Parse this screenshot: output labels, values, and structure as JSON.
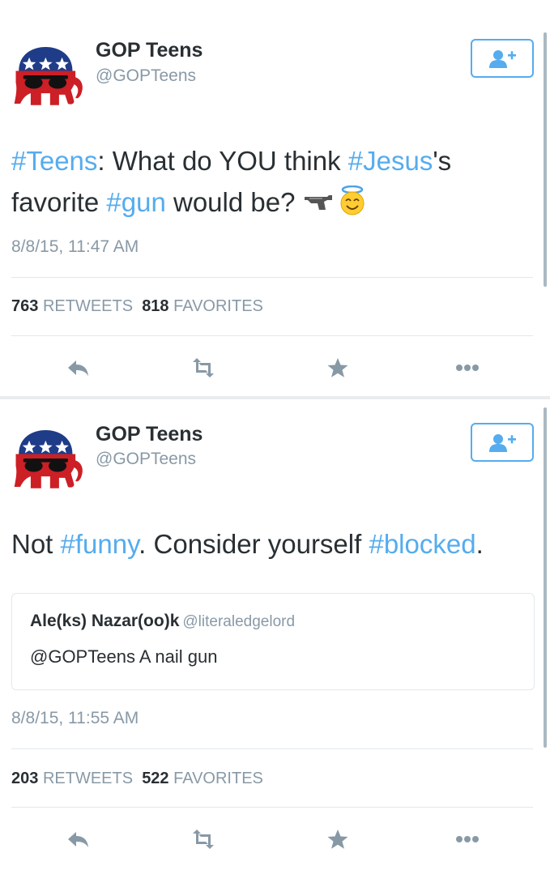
{
  "tweets": [
    {
      "name": "GOP Teens",
      "handle": "@GOPTeens",
      "text": [
        {
          "t": "#Teens",
          "hashtag": true
        },
        {
          "t": ": What do YOU think ",
          "hashtag": false
        },
        {
          "t": "#Jesus",
          "hashtag": true
        },
        {
          "t": "'s favorite ",
          "hashtag": false
        },
        {
          "t": "#gun",
          "hashtag": true
        },
        {
          "t": " would be? ",
          "hashtag": false
        }
      ],
      "emoji": [
        "gun-emoji",
        "angel-smile-emoji"
      ],
      "timestamp": "8/8/15, 11:47 AM",
      "retweets": "763",
      "retweets_label": "RETWEETS",
      "favorites": "818",
      "favorites_label": "FAVORITES"
    },
    {
      "name": "GOP Teens",
      "handle": "@GOPTeens",
      "text": [
        {
          "t": "Not ",
          "hashtag": false
        },
        {
          "t": "#funny",
          "hashtag": true
        },
        {
          "t": ". Consider yourself ",
          "hashtag": false
        },
        {
          "t": "#blocked",
          "hashtag": true
        },
        {
          "t": ".",
          "hashtag": false
        }
      ],
      "quote": {
        "name": "Ale(ks) Nazar(oo)k",
        "handle": "@literaledgelord",
        "text": "@GOPTeens A nail gun"
      },
      "timestamp": "8/8/15, 11:55 AM",
      "retweets": "203",
      "retweets_label": "RETWEETS",
      "favorites": "522",
      "favorites_label": "FAVORITES"
    }
  ],
  "icons": {
    "follow": "add-user-icon",
    "reply": "reply-icon",
    "retweet": "retweet-icon",
    "favorite": "star-icon",
    "more": "more-dots-icon"
  },
  "colors": {
    "accent": "#55acee",
    "text": "#292f33",
    "muted": "#8899a6",
    "icon": "#8899a6",
    "gop_red": "#cc1f26",
    "gop_blue": "#1f3c88"
  }
}
